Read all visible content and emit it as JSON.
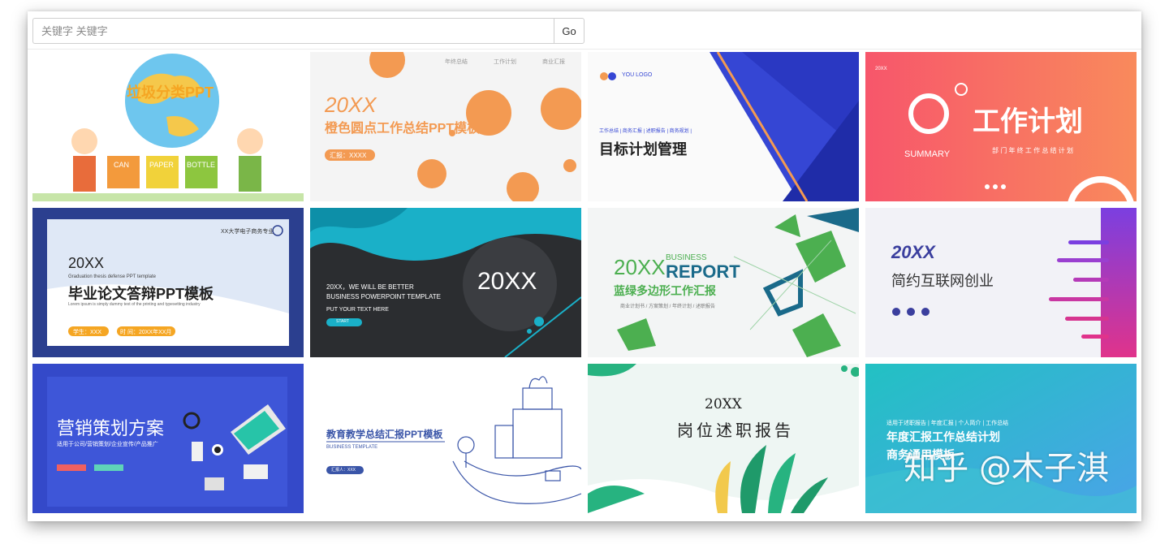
{
  "search": {
    "placeholder": "关键字 关键字",
    "value": "",
    "button_label": "Go"
  },
  "colors": {
    "accent_orange": "#f39a52",
    "accent_blue": "#3546d4",
    "accent_green": "#4caf50",
    "accent_teal": "#1ab0c8"
  },
  "cards": [
    {
      "title": "垃圾分类PPT",
      "labels": [
        "CAN",
        "PAPER",
        "BOTTLE"
      ]
    },
    {
      "number": "20XX",
      "title": "橙色圆点工作总结PPT模板",
      "nav": [
        "年终总结",
        "工作计划",
        "商业汇报"
      ],
      "tag": "汇报：XXXX"
    },
    {
      "logo": "YOU LOGO",
      "nav": "工作总结 | 商务汇报 | 述职报告 | 商务规划 |",
      "title": "目标计划管理"
    },
    {
      "title": "工作计划",
      "summary": "SUMMARY",
      "subtitle": "部 门 年 终 工 作 总 结 计 划",
      "corner": "20XX"
    },
    {
      "number": "20XX",
      "sub": "Graduation thesis defense PPT template",
      "title": "毕业论文答辩PPT模板",
      "desc": "Lorem ipsum is simply dummy text of the printing and typesetting industry",
      "school": "XX大学电子商务专业",
      "btn1": "学生：XXX",
      "btn2": "时 间：20XX年XX月"
    },
    {
      "big": "20XX",
      "line1": "20XX，WE WILL BE BETTER",
      "line2": "BUSINESS POWERPOINT TEMPLATE",
      "line3": "PUT YOUR TEXT HERE",
      "btn": "START"
    },
    {
      "number": "20XX",
      "business": "BUSINESS",
      "report": "REPORT",
      "title": "蓝绿多边形工作汇报",
      "sub": "商业计划书 / 方案策划 / 年终计划 / 述职报告"
    },
    {
      "number": "20XX",
      "title": "简约互联网创业"
    },
    {
      "title": "营销策划方案",
      "sub": "适用于公司/营销策划/企业宣传/产品推广"
    },
    {
      "title": "教育教学总结汇报PPT模板",
      "sub": "BUSINESS TEMPLATE",
      "tag": "汇报人：XXX"
    },
    {
      "number": "20XX",
      "title": "岗位述职报告"
    },
    {
      "sub": "适用于述职报告 | 年度汇报 | 个人简介 | 工作总结",
      "line1": "年度汇报工作总结计划",
      "line2": "商务通用模板"
    }
  ],
  "watermark": "知乎 @木子淇"
}
